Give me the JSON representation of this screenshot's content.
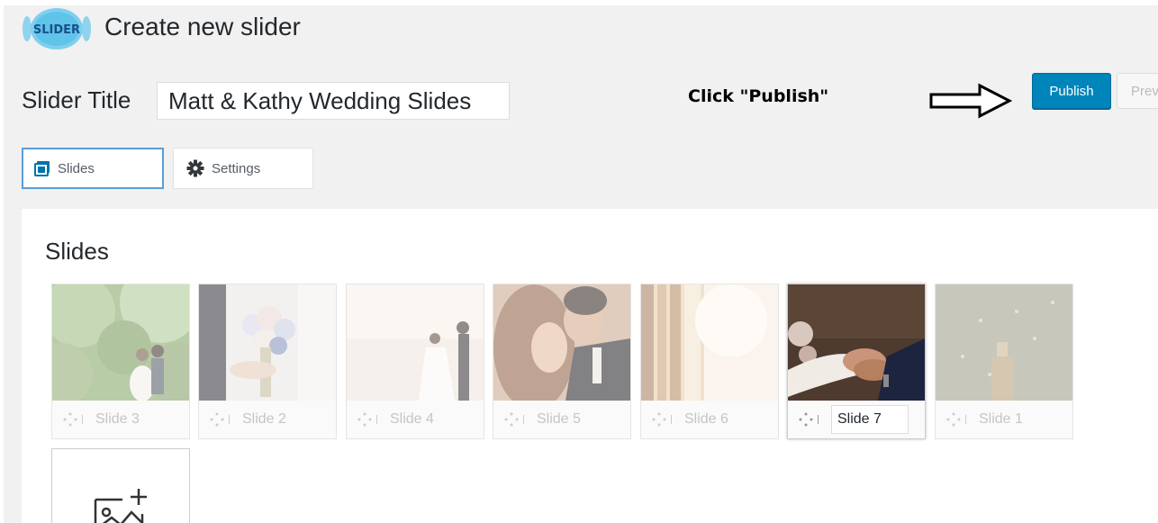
{
  "header": {
    "logo_text": "SLIDER",
    "page_title": "Create new slider"
  },
  "title_row": {
    "label": "Slider Title",
    "value": "Matt & Kathy Wedding Slides"
  },
  "callout": {
    "text": "Click \"Publish\""
  },
  "actions": {
    "publish_label": "Publish",
    "preview_label": "Prev"
  },
  "tabs": [
    {
      "label": "Slides",
      "icon": "image-icon",
      "active": true
    },
    {
      "label": "Settings",
      "icon": "gear-icon",
      "active": false
    }
  ],
  "panel": {
    "heading": "Slides"
  },
  "slides": [
    {
      "name": "Slide 3",
      "image": "couple-in-garden"
    },
    {
      "name": "Slide 2",
      "image": "bride-bouquet-hands"
    },
    {
      "name": "Slide 4",
      "image": "couple-at-lake"
    },
    {
      "name": "Slide 5",
      "image": "couple-embrace"
    },
    {
      "name": "Slide 6",
      "image": "sunlit-curtains"
    },
    {
      "name": "Slide 7",
      "image": "holding-hands-rings",
      "editing": true
    },
    {
      "name": "Slide 1",
      "image": "champagne-bottle"
    }
  ],
  "add_slide": {
    "icon": "add-image-icon"
  },
  "colors": {
    "primary": "#0085ba",
    "tab_active_border": "#5b9dd9",
    "background": "#f1f1f1"
  }
}
